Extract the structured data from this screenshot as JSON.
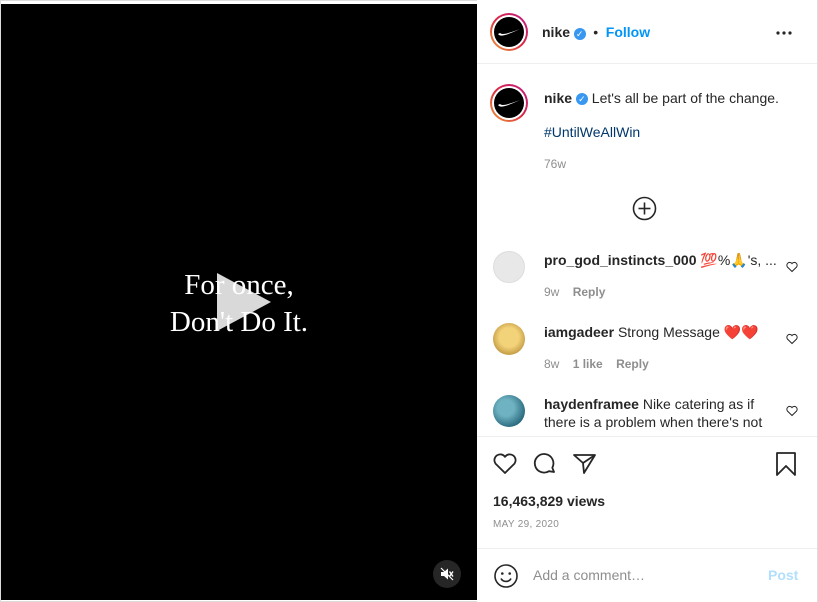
{
  "video": {
    "overlay_line1": "For once,",
    "overlay_line2": "Don't Do It."
  },
  "header": {
    "username": "nike",
    "separator": "•",
    "follow_label": "Follow"
  },
  "caption": {
    "username": "nike",
    "text": "Let's all be part of the change.",
    "hashtag": "#UntilWeAllWin",
    "age": "76w"
  },
  "comments": [
    {
      "username": "pro_god_instincts_000",
      "text": "💯%🙏's, ...",
      "age": "9w",
      "likes": "",
      "reply_label": "Reply"
    },
    {
      "username": "iamgadeer",
      "text": "Strong Message ❤️❤️",
      "age": "8w",
      "likes": "1 like",
      "reply_label": "Reply"
    },
    {
      "username": "haydenframee",
      "text": "Nike catering as if there is a problem when there's not",
      "age": "",
      "likes": "",
      "reply_label": ""
    }
  ],
  "stats": {
    "views": "16,463,829 views",
    "date": "MAY 29, 2020"
  },
  "composer": {
    "placeholder": "Add a comment…",
    "post_label": "Post"
  },
  "colors": {
    "accent": "#0095f6",
    "verified": "#3897f0",
    "hashtag": "#00376b",
    "muted": "#8e8e8e",
    "post_disabled": "#b2dffc"
  },
  "icons": [
    "swoosh-logo",
    "verified-badge-icon",
    "more-icon",
    "plus-circle-icon",
    "heart-icon",
    "comment-icon",
    "share-icon",
    "bookmark-icon",
    "emoji-icon",
    "play-icon",
    "mute-icon"
  ]
}
